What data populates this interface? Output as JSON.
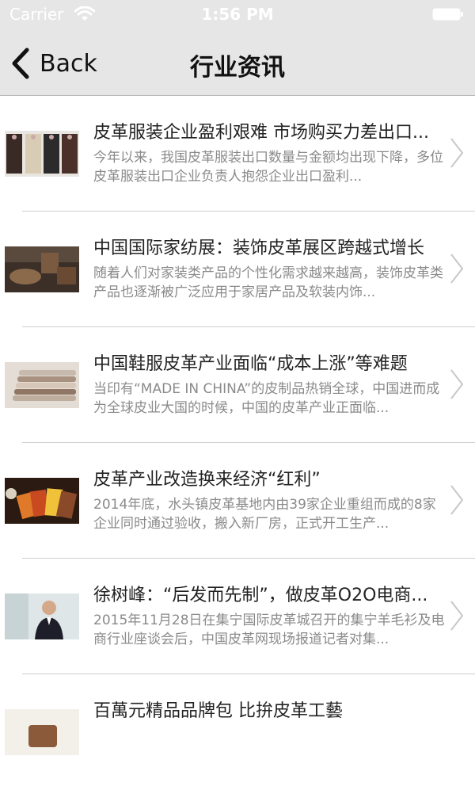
{
  "status_bar": {
    "carrier": "Carrier",
    "time": "1:56 PM"
  },
  "nav": {
    "back_label": "Back",
    "title": "行业资讯"
  },
  "news": [
    {
      "title": "皮革服装企业盈利艰难 市场购买力差出口...",
      "summary": "今年以来，我国皮革服装出口数量与金额均出现下降，多位皮革服装出口企业负责人抱怨企业出口盈利...",
      "thumb": "fashion-models"
    },
    {
      "title": "中国国际家纺展：装饰皮革展区跨越式增长",
      "summary": "随着人们对家装类产品的个性化需求越来越高，装饰皮革类产品也逐渐被广泛应用于家居产品及软装内饰...",
      "thumb": "leather-furniture"
    },
    {
      "title": "中国鞋服皮革产业面临“成本上涨”等难题",
      "summary": "当印有“MADE IN CHINA”的皮制品热销全球，中国进而成为全球皮业大国的时候，中国的皮革产业正面临...",
      "thumb": "leather-stack"
    },
    {
      "title": "皮革产业改造换来经济“红利”",
      "summary": "2014年底，水头镇皮革基地内由39家企业重组而成的8家企业同时通过验收，搬入新厂房，正式开工生产...",
      "thumb": "leather-samples"
    },
    {
      "title": "徐树峰：“后发而先制”，做皮革O2O电商...",
      "summary": "2015年11月28日在集宁国际皮革城召开的集宁羊毛衫及电商行业座谈会后，中国皮革网现场报道记者对集...",
      "thumb": "man-portrait"
    },
    {
      "title": "百萬元精品品牌包 比拚皮革工藝",
      "summary": "",
      "thumb": "handbag"
    }
  ]
}
